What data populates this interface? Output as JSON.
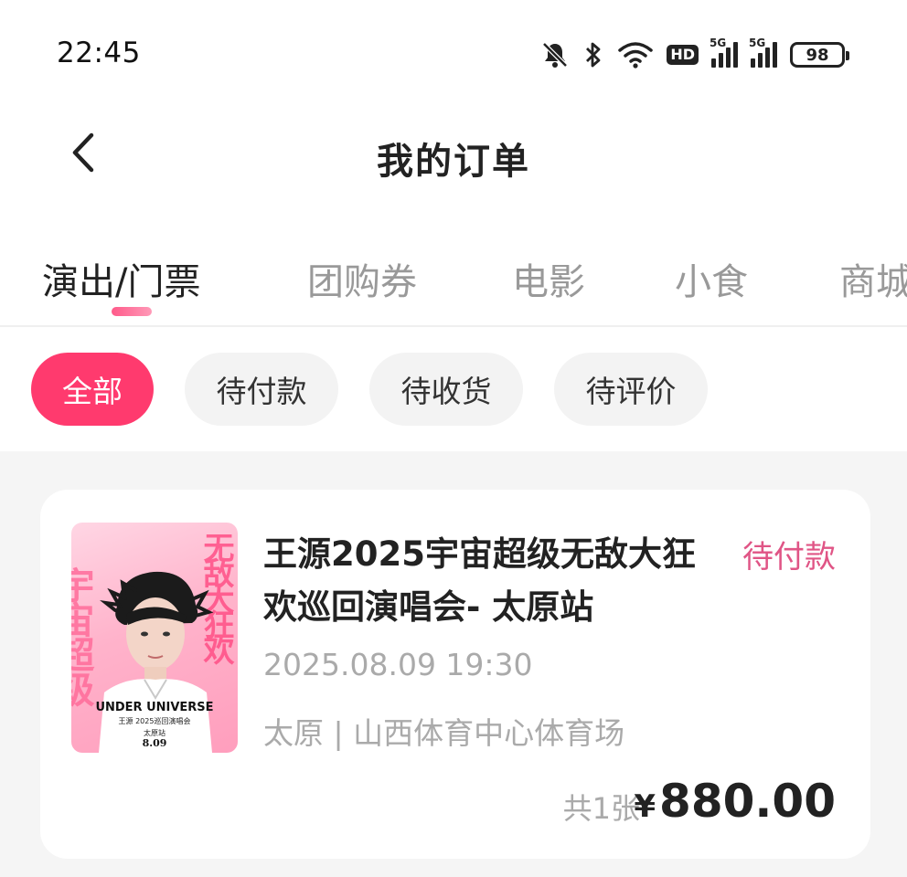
{
  "status_bar": {
    "time": "22:45",
    "network_label_1": "5G",
    "network_label_2": "5G",
    "hd_label": "HD",
    "battery": "98",
    "icons": [
      "mute-bell-icon",
      "bluetooth-icon",
      "wifi-icon",
      "hd-icon",
      "signal-5g-icon",
      "signal-5g-icon",
      "battery-icon"
    ]
  },
  "header": {
    "title": "我的订单",
    "back_icon": "chevron-left-icon"
  },
  "tabs": [
    {
      "label": "演出/门票",
      "active": true
    },
    {
      "label": "团购券",
      "active": false
    },
    {
      "label": "电影",
      "active": false
    },
    {
      "label": "小食",
      "active": false
    },
    {
      "label": "商城",
      "active": false
    }
  ],
  "filters": [
    {
      "label": "全部",
      "active": true
    },
    {
      "label": "待付款",
      "active": false
    },
    {
      "label": "待收货",
      "active": false
    },
    {
      "label": "待评价",
      "active": false
    }
  ],
  "orders": [
    {
      "title": "王源2025宇宙超级无敌大狂欢巡回演唱会- 太原站",
      "status": "待付款",
      "datetime": "2025.08.09 19:30",
      "venue": "太原 | 山西体育中心体育场",
      "quantity": "共1张",
      "currency": "¥",
      "price": "880.00",
      "poster": {
        "big_text_left": "宇宙超级",
        "big_text_right": "无敌大狂欢",
        "brand": "UNDER UNIVERSE",
        "subtitle": "王源 2025巡回演唱会",
        "city": "太原站",
        "date": "8.09"
      }
    }
  ],
  "colors": {
    "accent": "#ff3a6e",
    "status_pink": "#e05586",
    "muted": "#aaaaaa",
    "background": "#f5f5f5"
  }
}
